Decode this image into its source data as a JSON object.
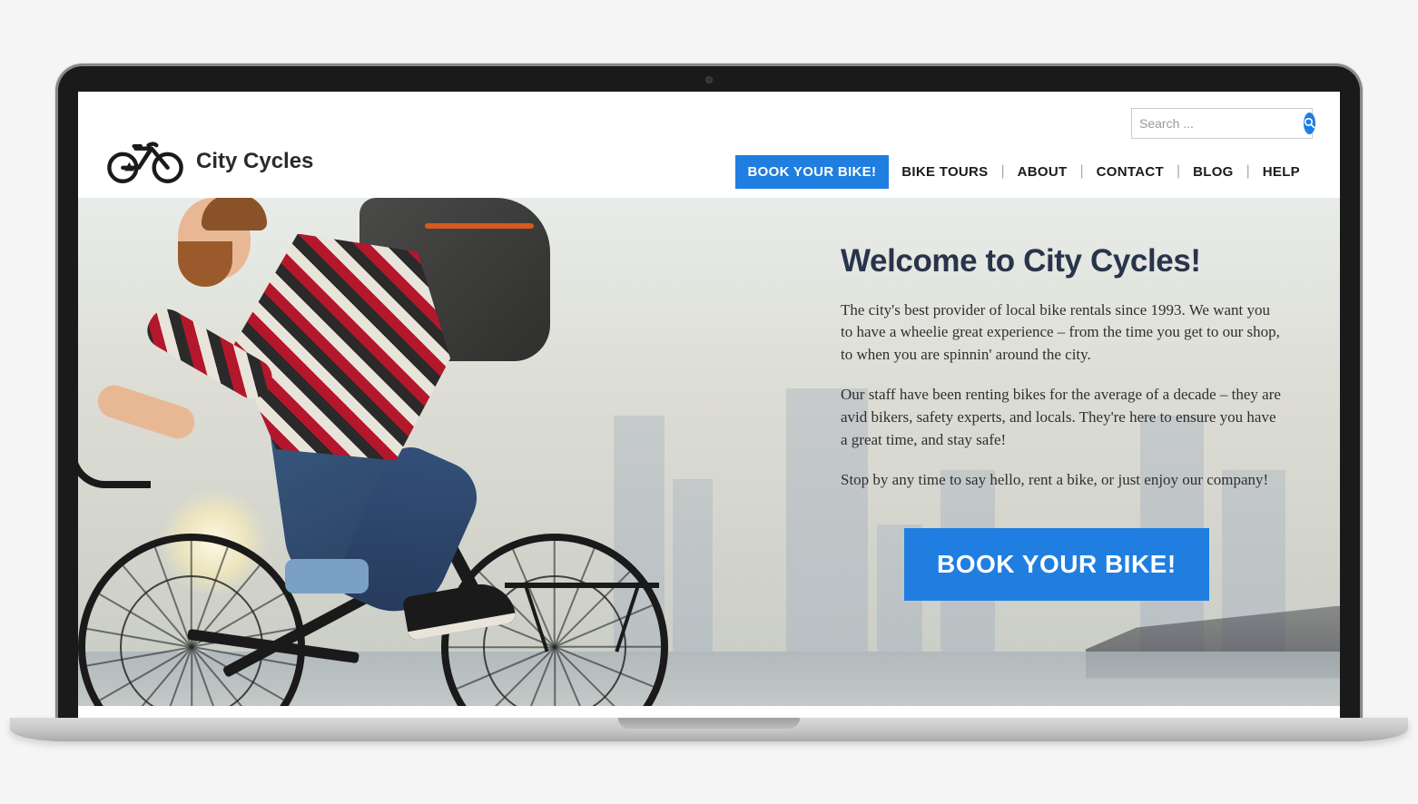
{
  "brand": {
    "name": "City Cycles"
  },
  "search": {
    "placeholder": "Search ..."
  },
  "nav": {
    "cta": "BOOK YOUR BIKE!",
    "items": [
      "BIKE TOURS",
      "ABOUT",
      "CONTACT",
      "BLOG",
      "HELP"
    ]
  },
  "hero": {
    "title": "Welcome to City Cycles!",
    "p1": "The city's best provider of local bike rentals since 1993. We want you to have a wheelie great experience – from the time you get to our shop, to when you are spinnin' around the city.",
    "p2": "Our staff have been renting bikes for the average of a decade – they are avid bikers, safety experts, and locals. They're here to ensure you have a great time, and stay safe!",
    "p3": "Stop by any time to say hello, rent a bike, or just enjoy our company!",
    "cta": "BOOK YOUR BIKE!"
  },
  "colors": {
    "accent": "#1f7ee0",
    "heading": "#28344a"
  }
}
